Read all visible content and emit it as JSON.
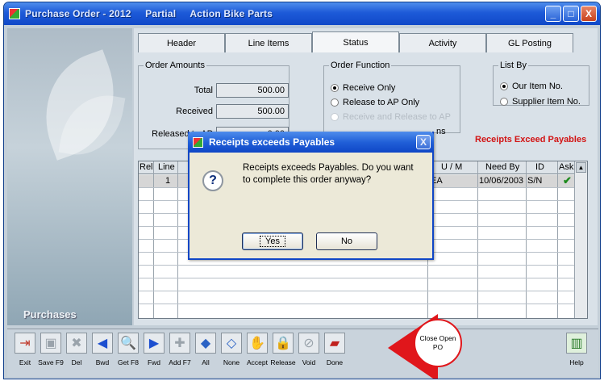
{
  "window": {
    "title_parts": [
      "Purchase Order - 2012",
      "Partial",
      "Action Bike Parts"
    ],
    "btn_min": "_",
    "btn_max": "□",
    "btn_close": "X"
  },
  "tabs": [
    "Header",
    "Line Items",
    "Status",
    "Activity",
    "GL Posting"
  ],
  "left_panel": {
    "label": "Purchases"
  },
  "order_amounts": {
    "legend": "Order Amounts",
    "rows": [
      {
        "label": "Total",
        "value": "500.00"
      },
      {
        "label": "Received",
        "value": "500.00"
      },
      {
        "label": "Released to AP",
        "value": "0.00"
      }
    ]
  },
  "order_function": {
    "legend": "Order Function",
    "options": [
      "Receive Only",
      "Release to AP Only",
      "Receive and Release to AP",
      "ns"
    ],
    "selected": "Receive Only"
  },
  "list_by": {
    "legend": "List By",
    "options": [
      "Our Item No.",
      "Supplier Item No."
    ],
    "selected": "Our Item No."
  },
  "warning": "Receipts Exceed Payables",
  "grid": {
    "headers": [
      "Rel",
      "Line",
      "U / M",
      "Need By",
      "ID",
      "Ask"
    ],
    "row1": {
      "line": "1",
      "um": "EA",
      "need_by": "10/06/2003",
      "id": "S/N",
      "ask": "✔"
    }
  },
  "dialog": {
    "title": "Receipts exceeds Payables",
    "message": "Receipts exceeds Payables.  Do you want to complete this order anyway?",
    "icon": "?",
    "close": "X",
    "yes": "Yes",
    "no": "No"
  },
  "toolbar": [
    {
      "label": "Exit",
      "icon": "exit-icon",
      "glyph": "⇥",
      "color": "#c0392b"
    },
    {
      "label": "Save F9",
      "icon": "save-icon",
      "glyph": "▣",
      "color": "#9aa3ab"
    },
    {
      "label": "Del",
      "icon": "trash-icon",
      "glyph": "✖",
      "color": "#9aa3ab"
    },
    {
      "label": "Bwd",
      "icon": "back-arrow-icon",
      "glyph": "◀",
      "color": "#1c4fd0"
    },
    {
      "label": "Get F8",
      "icon": "magnifier-icon",
      "glyph": "🔍",
      "color": "#1c4fd0"
    },
    {
      "label": "Fwd",
      "icon": "forward-arrow-icon",
      "glyph": "▶",
      "color": "#1c4fd0"
    },
    {
      "label": "Add F7",
      "icon": "plus-icon",
      "glyph": "✚",
      "color": "#9aa3ab"
    },
    {
      "label": "All",
      "icon": "all-icon",
      "glyph": "◆",
      "color": "#2a62c4"
    },
    {
      "label": "None",
      "icon": "none-icon",
      "glyph": "◇",
      "color": "#2a62c4"
    },
    {
      "label": "Accept",
      "icon": "handshake-icon",
      "glyph": "✋",
      "color": "#9aa3ab"
    },
    {
      "label": "Release",
      "icon": "padlock-icon",
      "glyph": "🔒",
      "color": "#333"
    },
    {
      "label": "Void",
      "icon": "void-icon",
      "glyph": "⊘",
      "color": "#9aa3ab"
    },
    {
      "label": "Done",
      "icon": "book-icon",
      "glyph": "▰",
      "color": "#c0211e"
    }
  ],
  "help": {
    "label": "Help",
    "icon": "help-icon"
  },
  "callout": "Close Open PO"
}
